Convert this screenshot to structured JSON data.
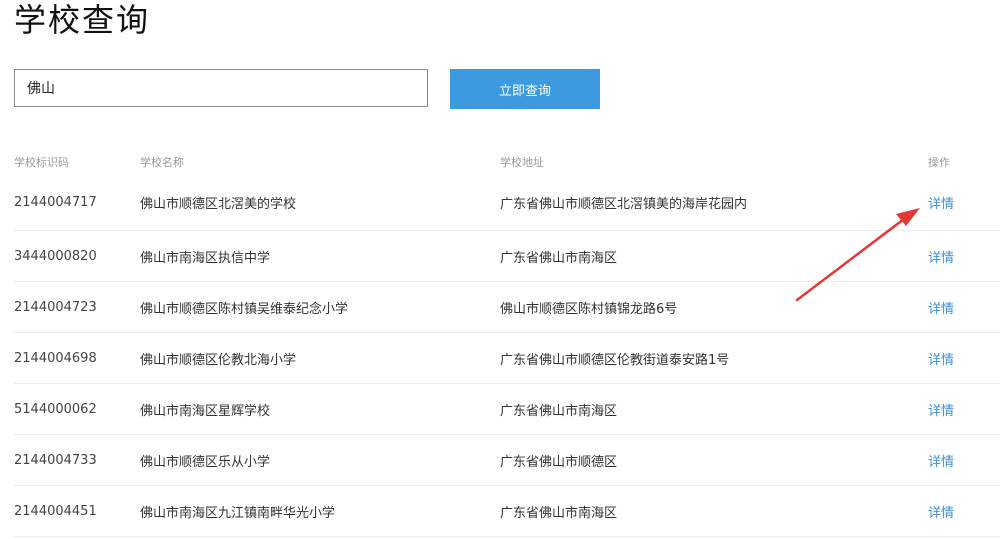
{
  "page": {
    "title": "学校查询"
  },
  "search": {
    "value": "佛山",
    "button_label": "立即查询"
  },
  "table": {
    "headers": {
      "code": "学校标识码",
      "name": "学校名称",
      "address": "学校地址",
      "action": "操作"
    },
    "rows": [
      {
        "code": "2144004717",
        "name": "佛山市顺德区北滘美的学校",
        "address": "广东省佛山市顺德区北滘镇美的海岸花园内",
        "action": "详情"
      },
      {
        "code": "3444000820",
        "name": "佛山市南海区执信中学",
        "address": "广东省佛山市南海区",
        "action": "详情"
      },
      {
        "code": "2144004723",
        "name": "佛山市顺德区陈村镇吴维泰纪念小学",
        "address": "佛山市顺德区陈村镇锦龙路6号",
        "action": "详情"
      },
      {
        "code": "2144004698",
        "name": "佛山市顺德区伦教北海小学",
        "address": "广东省佛山市顺德区伦教街道泰安路1号",
        "action": "详情"
      },
      {
        "code": "5144000062",
        "name": "佛山市南海区星辉学校",
        "address": "广东省佛山市南海区",
        "action": "详情"
      },
      {
        "code": "2144004733",
        "name": "佛山市顺德区乐从小学",
        "address": "广东省佛山市顺德区",
        "action": "详情"
      },
      {
        "code": "2144004451",
        "name": "佛山市南海区九江镇南畔华光小学",
        "address": "广东省佛山市南海区",
        "action": "详情"
      }
    ]
  },
  "annotation": {
    "arrow_color": "#e53935"
  },
  "colors": {
    "accent": "#3d9ae0",
    "link": "#3d8fd6"
  }
}
